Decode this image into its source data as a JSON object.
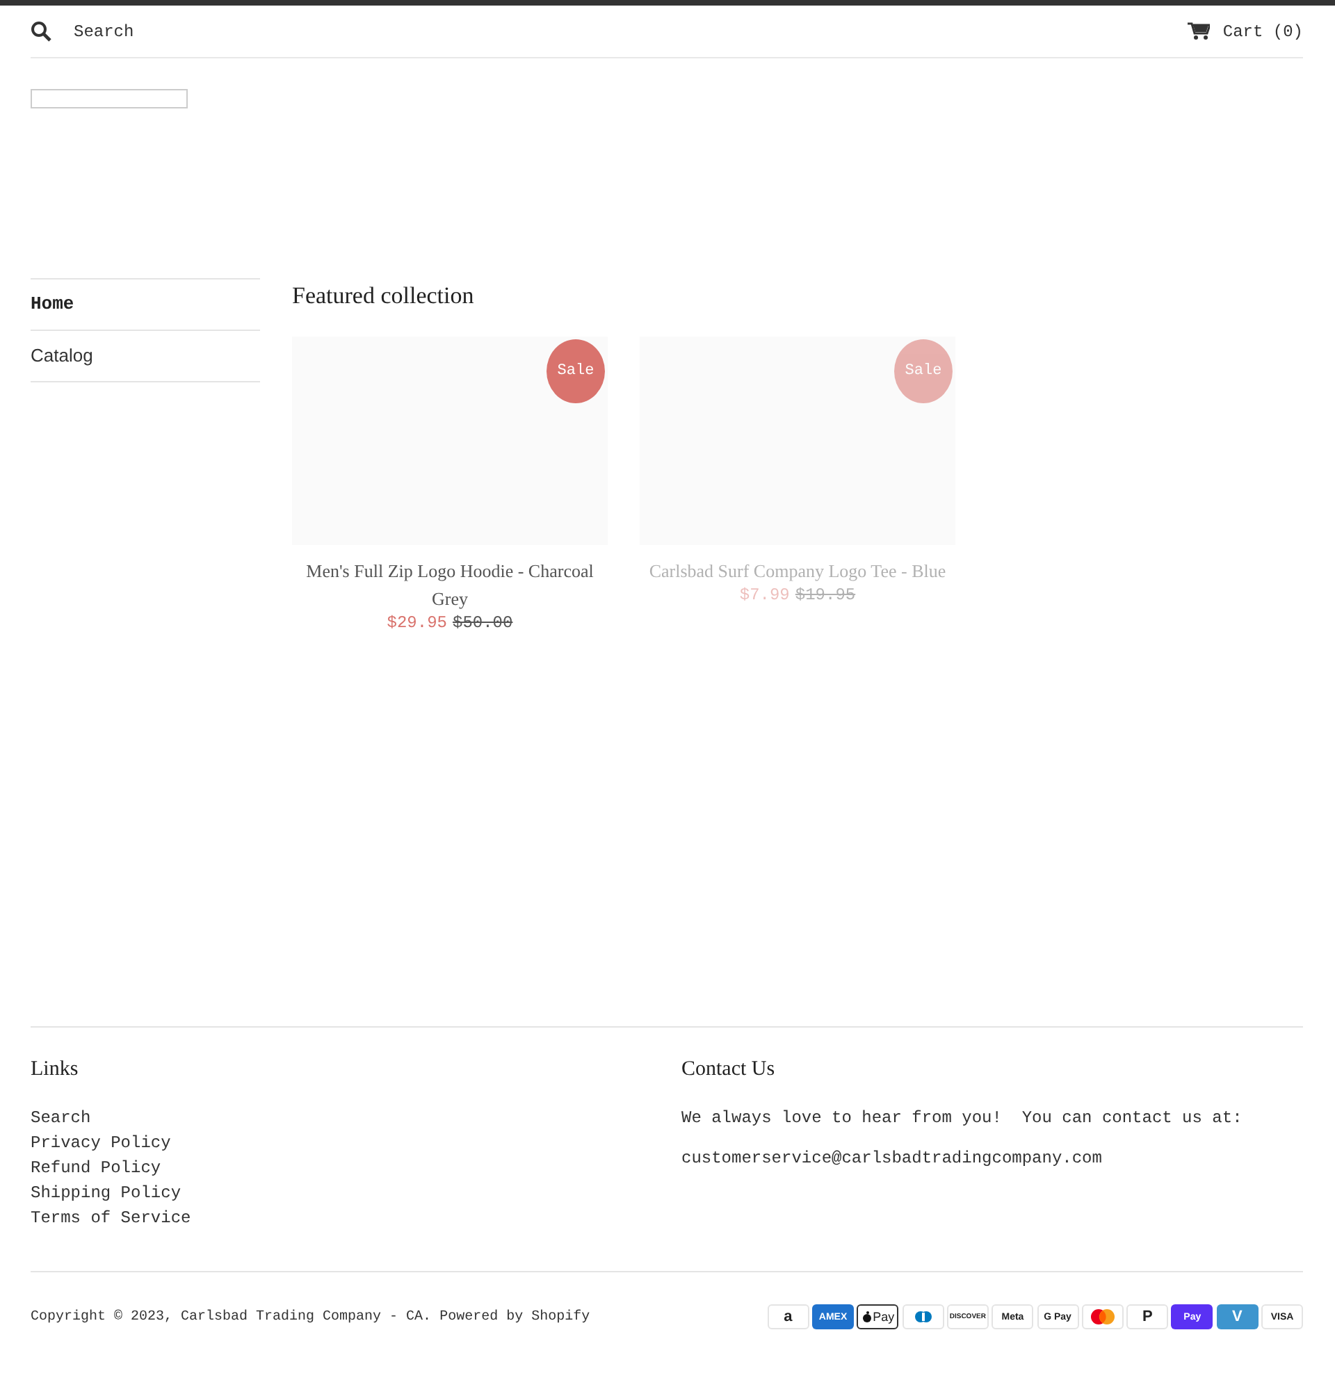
{
  "header": {
    "search_placeholder": "Search",
    "cart": "Cart (0)"
  },
  "sidebar": {
    "items": [
      {
        "label": "Home",
        "selected": true
      },
      {
        "label": "Catalog",
        "selected": false
      }
    ]
  },
  "featured": {
    "title": "Featured collection",
    "products": [
      {
        "title": "Men's Full Zip Logo Hoodie - Charcoal Grey",
        "badge": "Sale",
        "price": "$29.95",
        "compare_price": "$50.00",
        "faded": false
      },
      {
        "title": "Carlsbad Surf Company Logo Tee - Blue",
        "badge": "Sale",
        "price": "$7.99",
        "compare_price": "$19.95",
        "faded": true
      }
    ]
  },
  "footer": {
    "links_title": "Links",
    "links": [
      "Search",
      "Privacy Policy",
      "Refund Policy",
      "Shipping Policy",
      "Terms of Service"
    ],
    "contact_title": "Contact Us",
    "contact_text": "We always love to hear from you!  You can contact us at:",
    "contact_email": "customerservice@carlsbadtradingcompany.com",
    "copyright": "Copyright © 2023, Carlsbad Trading Company - CA.",
    "powered_by": "Powered by Shopify",
    "payment_icons": [
      {
        "label": "a",
        "color": "#ffffff",
        "kind": "text"
      },
      {
        "label": "AMEX",
        "color": "#1f72cd",
        "kind": "text"
      },
      {
        "label": "Pay",
        "color": "#ffffff",
        "kind": "apple"
      },
      {
        "color": "#ffffff",
        "kind": "diners"
      },
      {
        "label": "DISCOVER",
        "color": "#ffffff",
        "kind": "text"
      },
      {
        "label": "Meta",
        "color": "#ffffff",
        "kind": "text"
      },
      {
        "label": "G Pay",
        "color": "#ffffff",
        "kind": "text"
      },
      {
        "color": "#ffffff",
        "kind": "mastercard"
      },
      {
        "label": "P",
        "color": "#ffffff",
        "kind": "text"
      },
      {
        "label": "Pay",
        "color": "#5a31f4",
        "kind": "text"
      },
      {
        "label": "V",
        "color": "#3d95ce",
        "kind": "text"
      },
      {
        "label": "VISA",
        "color": "#ffffff",
        "kind": "text"
      }
    ]
  }
}
